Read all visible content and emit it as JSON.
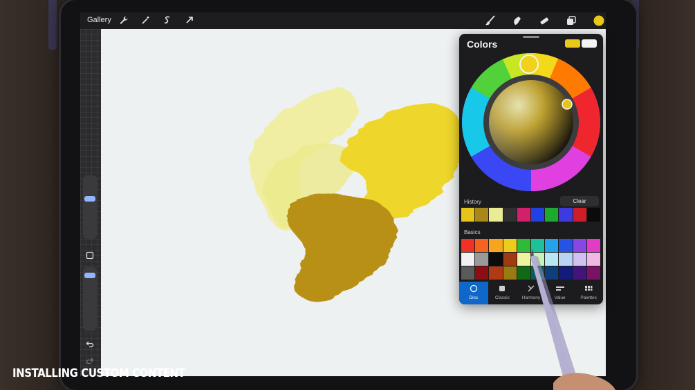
{
  "topbar": {
    "gallery_label": "Gallery",
    "left_icons": [
      "wrench-icon",
      "magic-wand-icon",
      "selection-s-icon",
      "transform-arrow-icon"
    ],
    "right_icons": [
      "brush-icon",
      "smudge-icon",
      "eraser-icon",
      "layers-icon",
      "color-dot-icon"
    ],
    "active_color": "#e8c81a"
  },
  "colors_panel": {
    "title": "Colors",
    "current_color": "#e8c81a",
    "previous_color": "#f4f4f4",
    "history": {
      "label": "History",
      "clear_label": "Clear",
      "swatches": [
        "#e7c41c",
        "#a98719",
        "#eceb95",
        "#303032",
        "#d3206c",
        "#1f42e0",
        "#1eaa2e",
        "#3d3be0",
        "#cf1d28",
        "#0b0b0b"
      ]
    },
    "basics": {
      "label": "Basics",
      "swatches": [
        "#ef3225",
        "#f6621f",
        "#f6a51f",
        "#eccc1d",
        "#2fba3a",
        "#1ec29a",
        "#26a3e8",
        "#2553e6",
        "#8a46e4",
        "#e03cc4",
        "#f1f1f1",
        "#9a9a9a",
        "#0c0c0c",
        "#a13a10",
        "#eef3a0",
        "#c7f2b8",
        "#b8e9f2",
        "#b8d4f2",
        "#d2c0f2",
        "#f2b8e4",
        "#5a5a5a",
        "#8d0e12",
        "#b23a12",
        "#9a7a12",
        "#0f6a16",
        "#0d5a5a",
        "#0d3f7a",
        "#121a7a",
        "#43157a",
        "#7a1266"
      ]
    },
    "tabs": [
      {
        "label": "Disc",
        "icon": "disc-icon",
        "active": true
      },
      {
        "label": "Classic",
        "icon": "classic-square-icon",
        "active": false
      },
      {
        "label": "Harmony",
        "icon": "harmony-icon",
        "active": false
      },
      {
        "label": "Value",
        "icon": "value-sliders-icon",
        "active": false
      },
      {
        "label": "Palettes",
        "icon": "palettes-grid-icon",
        "active": false
      }
    ]
  },
  "sidebar": {
    "icons": [
      "square-modify-icon",
      "undo-icon",
      "redo-icon"
    ]
  },
  "watermark": "INSTALLING CUSTOM CONTENT"
}
